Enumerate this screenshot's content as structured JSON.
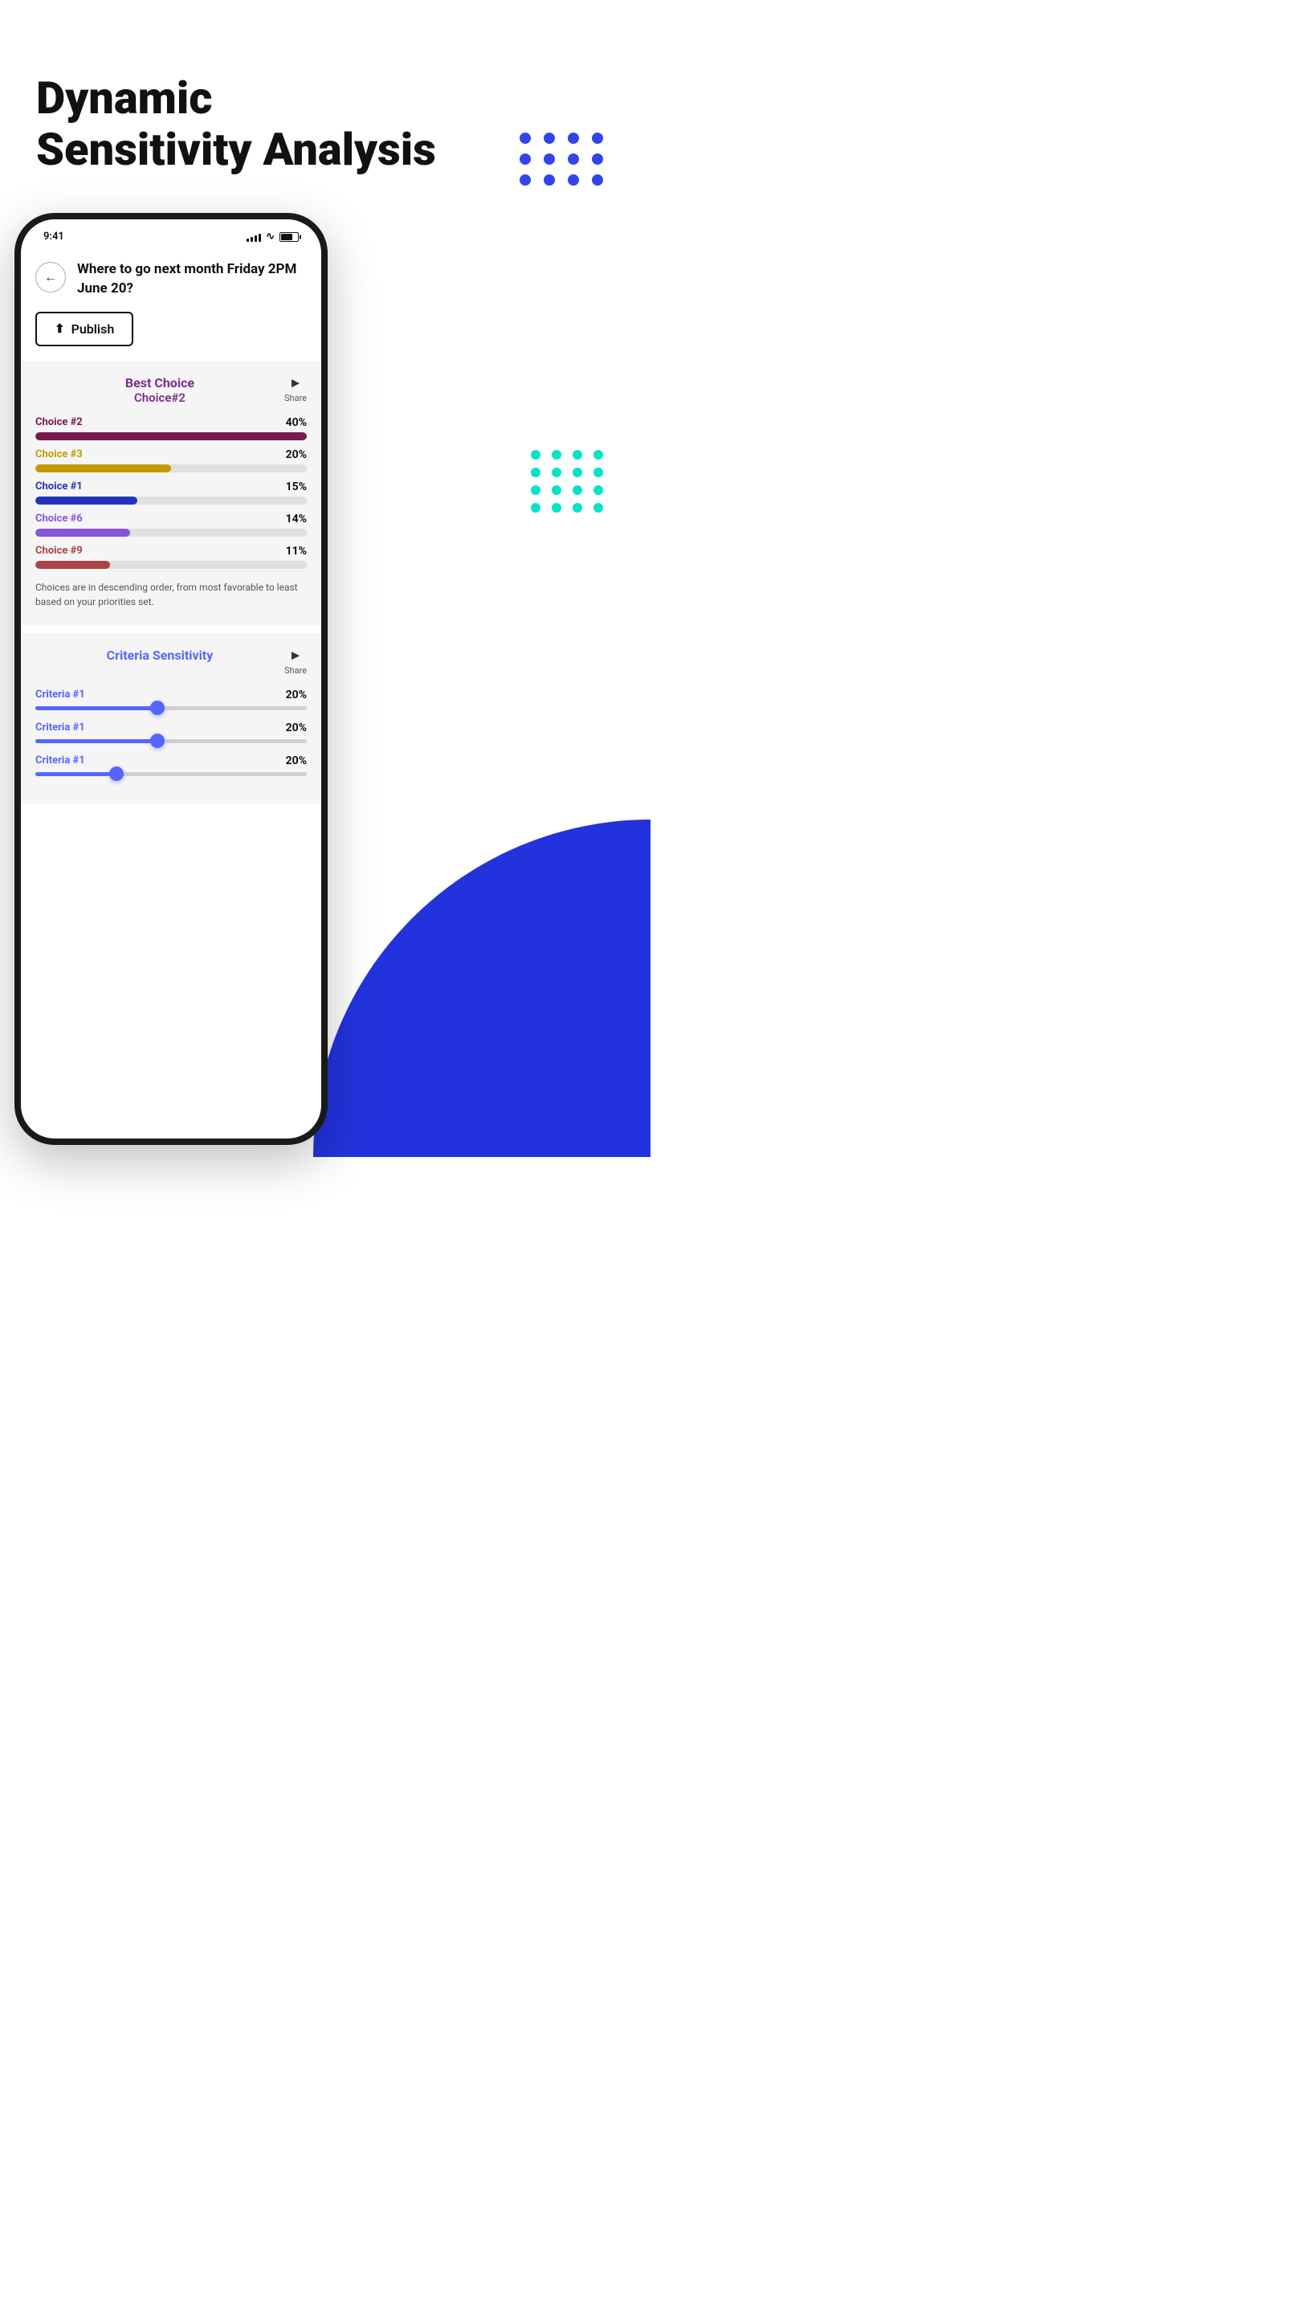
{
  "page": {
    "title_line1": "Dynamic",
    "title_line2": "Sensitivity Analysis",
    "bg_blue_color": "#2233dd",
    "dot_blue_color": "#3344ee",
    "dot_cyan_color": "#00e5c8"
  },
  "status_bar": {
    "time": "9:41",
    "signal_bars": [
      4,
      6,
      8,
      10,
      12
    ],
    "battery_level": "70%"
  },
  "phone": {
    "question": "Where to go next month Friday 2PM June 20?",
    "publish_button": "Publish",
    "back_icon": "←"
  },
  "best_choice": {
    "section_title": "Best Choice",
    "section_subtitle": "Choice#2",
    "share_label": "Share",
    "bars": [
      {
        "label": "Choice #2",
        "pct": "40%",
        "value": 40,
        "color": "#7B1A4E"
      },
      {
        "label": "Choice #3",
        "pct": "20%",
        "value": 20,
        "color": "#C49A00"
      },
      {
        "label": "Choice #1",
        "pct": "15%",
        "value": 15,
        "color": "#2233BB"
      },
      {
        "label": "Choice #6",
        "pct": "14%",
        "value": 14,
        "color": "#8855DD"
      },
      {
        "label": "Choice #9",
        "pct": "11%",
        "value": 11,
        "color": "#AA4444"
      }
    ],
    "note": "Choices are in descending order, from most favorable to least based on your priorities set."
  },
  "criteria_sensitivity": {
    "section_title": "Criteria Sensitivity",
    "share_label": "Share",
    "criteria": [
      {
        "label": "Criteria #1",
        "pct": "20%",
        "value": 45,
        "thumb_pct": 45,
        "color": "#5566ff"
      },
      {
        "label": "Criteria #1",
        "pct": "20%",
        "value": 45,
        "thumb_pct": 45,
        "color": "#5566ff"
      },
      {
        "label": "Criteria #1",
        "pct": "20%",
        "value": 30,
        "thumb_pct": 30,
        "color": "#5566ff"
      }
    ]
  }
}
